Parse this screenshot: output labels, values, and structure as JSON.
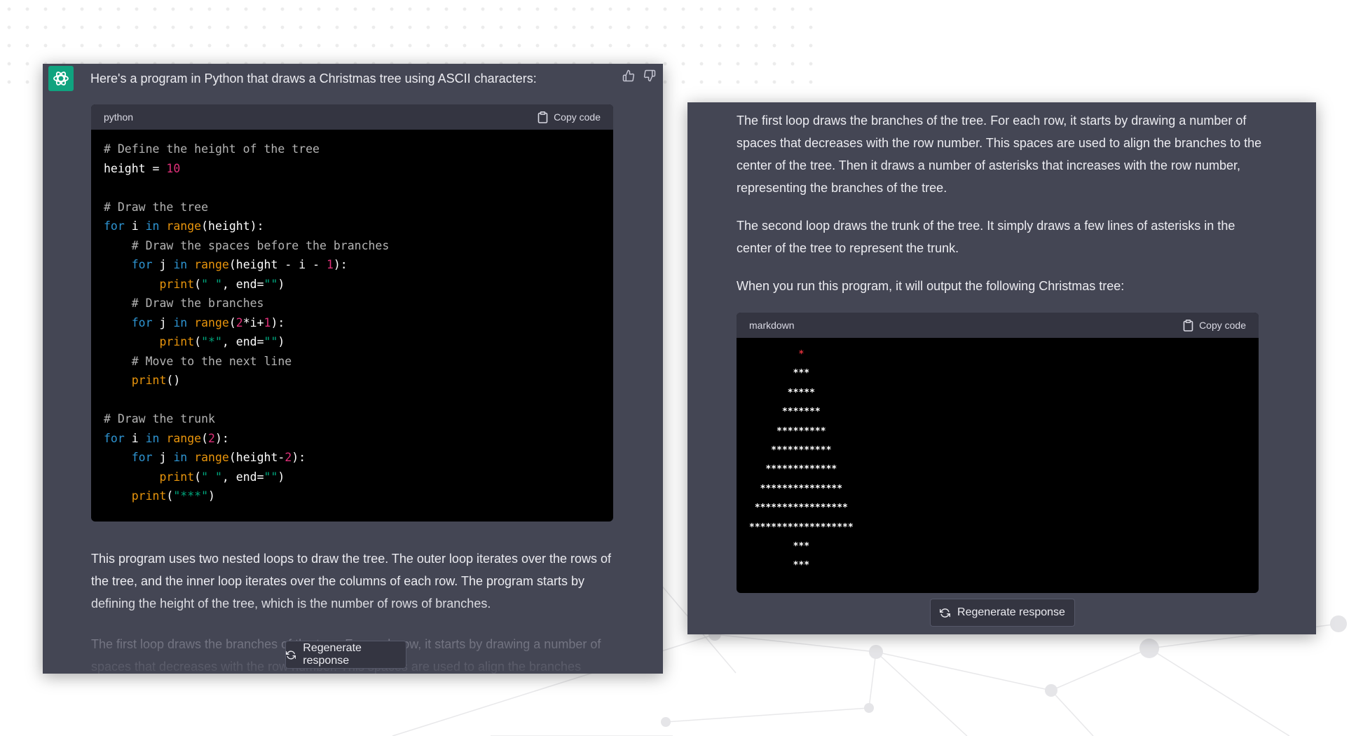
{
  "left_panel": {
    "intro": "Here's a program in Python that draws a Christmas tree using ASCII characters:",
    "code_language": "python",
    "copy_label": "Copy code",
    "code": {
      "c1": "# Define the height of the tree",
      "c2": "# Draw the tree",
      "c3": "# Draw the spaces before the branches",
      "c4": "# Draw the branches",
      "c5": "# Move to the next line",
      "c6": "# Draw the trunk"
    },
    "paragraph_1": "This program uses two nested loops to draw the tree. The outer loop iterates over the rows of the tree, and the inner loop iterates over the columns of each row. The program starts by defining the height of the tree, which is the number of rows of branches.",
    "paragraph_2": "The first loop draws the branches of the tree. For each row, it starts by drawing a number of spaces that decreases with the row number. This spaces are used to align the branches",
    "regenerate_label": "Regenerate response"
  },
  "right_panel": {
    "paragraph_1": "The first loop draws the branches of the tree. For each row, it starts by drawing a number of spaces that decreases with the row number. This spaces are used to align the branches to the center of the tree. Then it draws a number of asterisks that increases with the row number, representing the branches of the tree.",
    "paragraph_2": "The second loop draws the trunk of the tree. It simply draws a few lines of asterisks in the center of the tree to represent the trunk.",
    "paragraph_3": "When you run this program, it will output the following Christmas tree:",
    "code_language": "markdown",
    "copy_label": "Copy code",
    "tree_lines": [
      "         *",
      "        ***",
      "       *****",
      "      *******",
      "     *********",
      "    ***********",
      "   *************",
      "  ***************",
      " *****************",
      "*******************",
      "        ***",
      "        ***"
    ],
    "regenerate_label": "Regenerate response"
  },
  "colors": {
    "panel_bg": "#444654",
    "code_bg": "#000000",
    "code_header_bg": "#343541",
    "brand": "#10a37f",
    "keyword": "#2e95d3",
    "function": "#e9950c",
    "number": "#df3079",
    "string": "#00a67d",
    "tree_star": "#e0303b"
  },
  "icons": [
    "openai-logo-icon",
    "thumbs-up-icon",
    "thumbs-down-icon",
    "clipboard-icon",
    "refresh-icon"
  ]
}
